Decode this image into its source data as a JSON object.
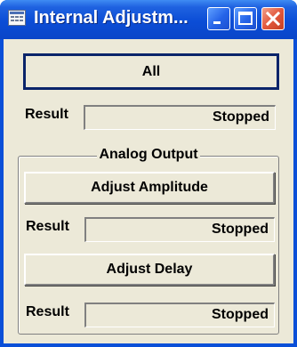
{
  "window": {
    "title": "Internal Adjustm...",
    "colors": {
      "titlebar": "#0a4fd8",
      "client": "#ece9d8",
      "focus_border": "#0a246a"
    }
  },
  "main": {
    "all_button": "All",
    "result_label": "Result",
    "result_value": "Stopped"
  },
  "analog_output": {
    "title": "Analog Output",
    "adjust_amplitude_button": "Adjust Amplitude",
    "amplitude_result_label": "Result",
    "amplitude_result_value": "Stopped",
    "adjust_delay_button": "Adjust Delay",
    "delay_result_label": "Result",
    "delay_result_value": "Stopped"
  }
}
